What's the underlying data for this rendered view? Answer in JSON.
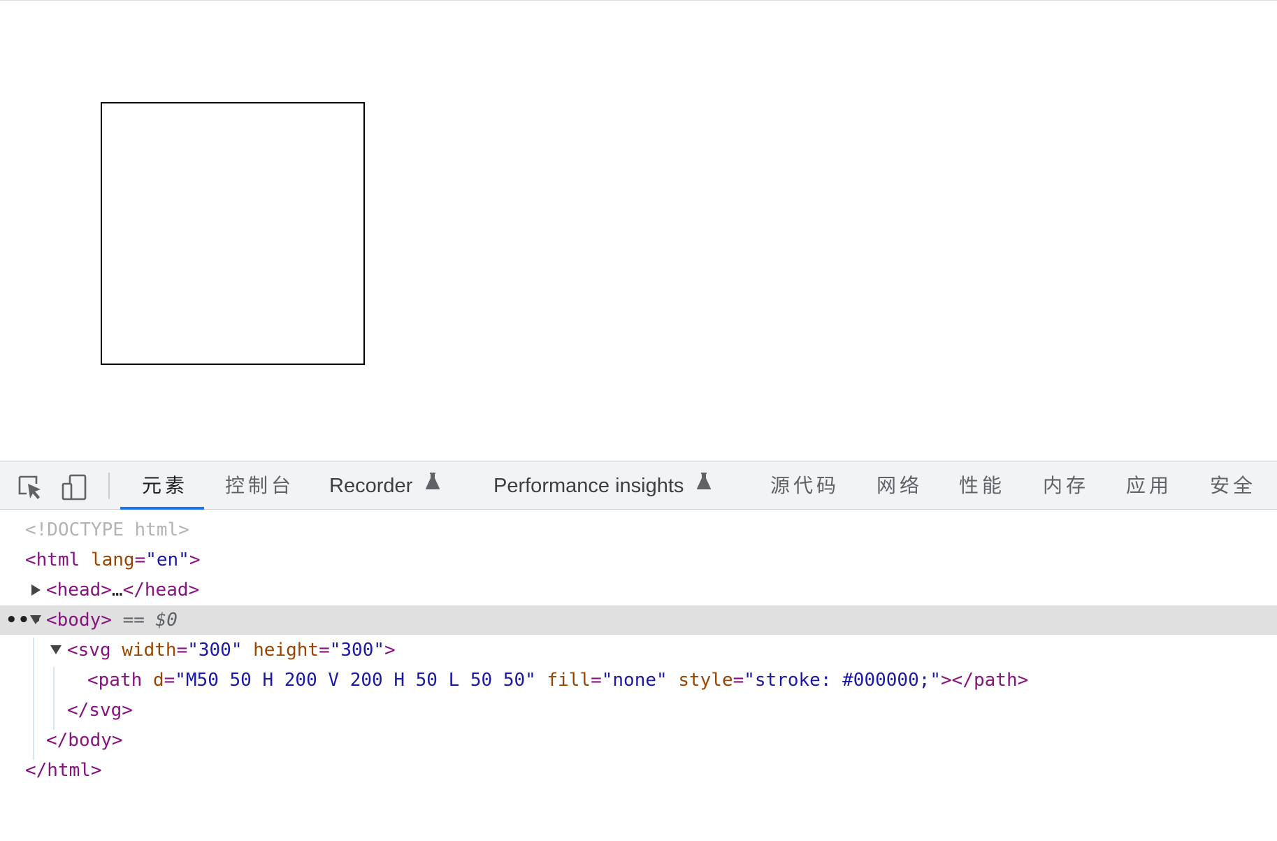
{
  "toolbar": {
    "inspect_icon": "inspect-element-icon",
    "device_icon": "device-toolbar-icon",
    "tabs": [
      {
        "label": "元素",
        "active": true
      },
      {
        "label": "控制台"
      },
      {
        "label": "Recorder",
        "experimental": true
      },
      {
        "label": "Performance insights",
        "experimental": true
      },
      {
        "label": "源代码"
      },
      {
        "label": "网络"
      },
      {
        "label": "性能"
      },
      {
        "label": "内存"
      },
      {
        "label": "应用"
      },
      {
        "label": "安全"
      }
    ],
    "accent_color": "#1a73e8"
  },
  "tree": {
    "doctype": "<!DOCTYPE html>",
    "html_open": {
      "tag_open": "<html",
      "attr_name": "lang",
      "attr_eq": "=",
      "attr_value": "\"en\"",
      "tag_close": ">"
    },
    "head": {
      "open": "<head>",
      "ellipsis": "…",
      "close": "</head>"
    },
    "body": {
      "open": "<body>",
      "marker": "== $0",
      "dots": "•••"
    },
    "svg": {
      "tag_open": "<svg",
      "attr1_name": "width",
      "attr1_value": "\"300\"",
      "attr2_name": "height",
      "attr2_value": "\"300\"",
      "tag_close": ">",
      "eq": "="
    },
    "path": {
      "tag_open": "<path",
      "attr1_name": "d",
      "attr1_value": "\"M50 50 H 200 V 200 H 50 L 50 50\"",
      "attr2_name": "fill",
      "attr2_value": "\"none\"",
      "attr3_name": "style",
      "attr3_value": "\"stroke: #000000;\"",
      "tag_close": "></path>",
      "eq": "="
    },
    "svg_close": "</svg>",
    "body_close": "</body>",
    "html_close": "</html>",
    "colors": {
      "tag": "#881280",
      "attr_name": "#994500",
      "attr_value": "#1a1aa6",
      "doctype": "#b4b4b4",
      "selected_row": "#e0e0e0"
    }
  }
}
